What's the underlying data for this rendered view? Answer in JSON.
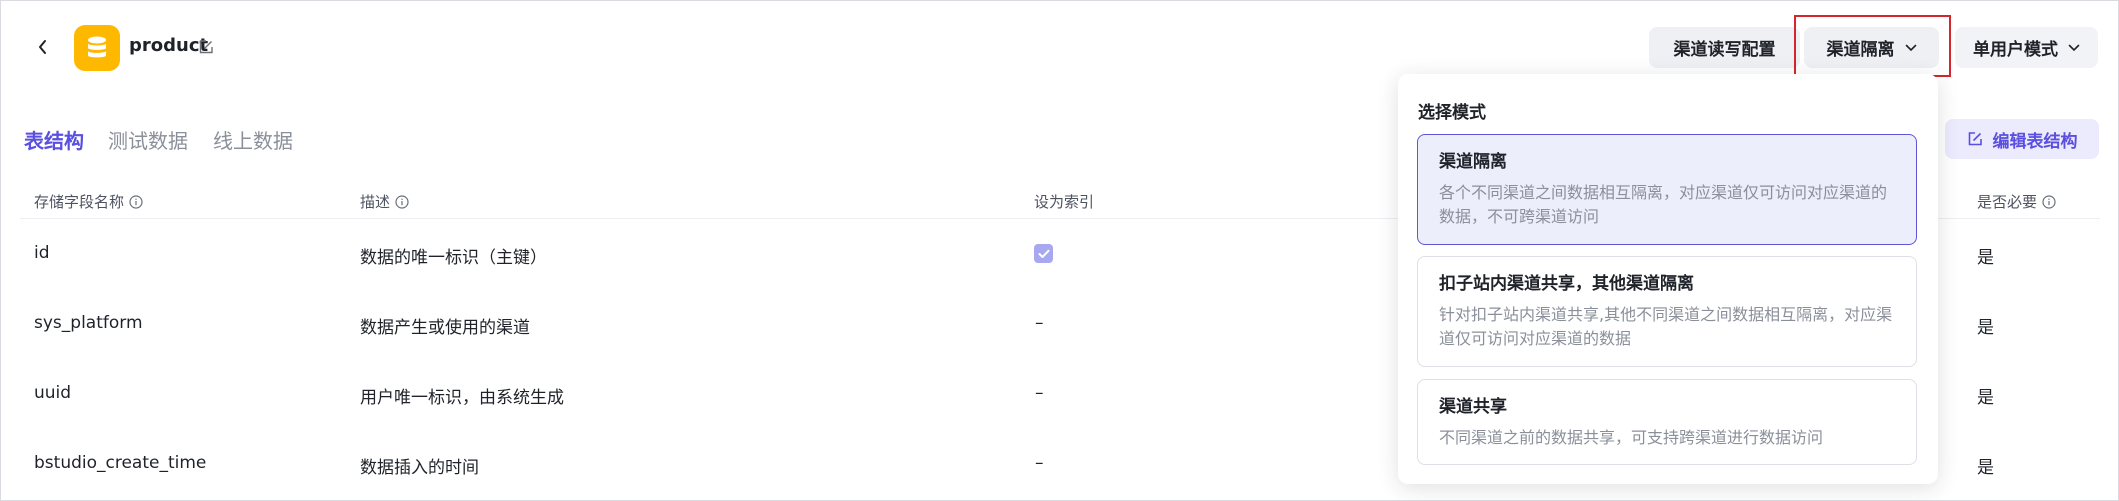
{
  "header": {
    "title": "product",
    "buttons": {
      "channel_rw_config": "渠道读写配置",
      "channel_isolation": "渠道隔离",
      "single_user_mode": "单用户模式"
    }
  },
  "tabs": [
    {
      "label": "表结构",
      "active": true
    },
    {
      "label": "测试数据",
      "active": false
    },
    {
      "label": "线上数据",
      "active": false
    }
  ],
  "edit_structure_label": "编辑表结构",
  "table": {
    "headers": {
      "field_name": "存储字段名称",
      "description": "描述",
      "index": "设为索引",
      "required": "是否必要"
    },
    "rows": [
      {
        "name": "id",
        "description": "数据的唯一标识（主键）",
        "index": true,
        "index_text": "",
        "required": "是"
      },
      {
        "name": "sys_platform",
        "description": "数据产生或使用的渠道",
        "index": false,
        "index_text": "–",
        "required": "是"
      },
      {
        "name": "uuid",
        "description": "用户唯一标识，由系统生成",
        "index": false,
        "index_text": "–",
        "required": "是"
      },
      {
        "name": "bstudio_create_time",
        "description": "数据插入的时间",
        "index": false,
        "index_text": "–",
        "required": "是"
      }
    ]
  },
  "dropdown": {
    "title": "选择模式",
    "options": [
      {
        "name": "渠道隔离",
        "description": "各个不同渠道之间数据相互隔离，对应渠道仅可访问对应渠道的数据，不可跨渠道访问",
        "selected": true
      },
      {
        "name": "扣子站内渠道共享，其他渠道隔离",
        "description": "针对扣子站内渠道共享,其他不同渠道之间数据相互隔离，对应渠道仅可访问对应渠道的数据",
        "selected": false
      },
      {
        "name": "渠道共享",
        "description": "不同渠道之前的数据共享，可支持跨渠道进行数据访问",
        "selected": false
      }
    ]
  },
  "colors": {
    "accent": "#5b4fe0",
    "app_icon": "#ffb800",
    "highlight_border": "#d3262f"
  }
}
